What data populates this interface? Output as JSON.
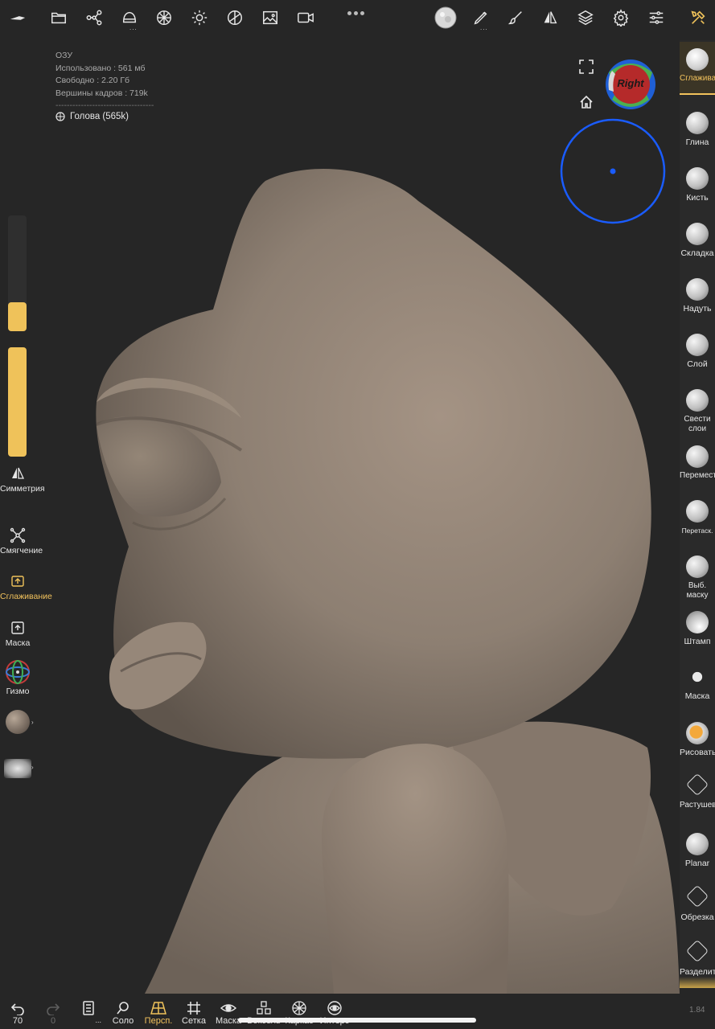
{
  "stats": {
    "title": "ОЗУ",
    "used": "Использовано : 561 мб",
    "free": "Свободно : 2.20 Гб",
    "vertices": "Вершины кадров : 719k",
    "separator": "-----------------------------------",
    "mesh_name": "Голова (565k)"
  },
  "gizmo": {
    "face_label": "Right"
  },
  "left_panel": {
    "symmetry": "Симметрия",
    "smoothing": "Смягчение",
    "smooth_active": "Сглаживание",
    "mask": "Маска",
    "gizmo": "Гизмо",
    "slider_top_level": 0.25,
    "slider_bottom_level": 1.0
  },
  "brushes": [
    {
      "label": "Сглаживание",
      "icon": "smooth-brush-icon",
      "active": true
    },
    {
      "label": "Глина",
      "icon": "clay-brush-icon"
    },
    {
      "label": "Кисть",
      "icon": "brush-icon"
    },
    {
      "label": "Складка",
      "icon": "crease-brush-icon"
    },
    {
      "label": "Надуть",
      "icon": "inflate-brush-icon"
    },
    {
      "label": "Слой",
      "icon": "layer-brush-icon"
    },
    {
      "label": "Свести слои",
      "icon": "flatten-brush-icon"
    },
    {
      "label": "Переместить",
      "icon": "move-brush-icon"
    },
    {
      "label": "Перетаск.",
      "icon": "drag-brush-icon"
    },
    {
      "label": "Выб. маску",
      "icon": "select-mask-brush-icon"
    },
    {
      "label": "Штамп",
      "icon": "stamp-brush-icon"
    },
    {
      "label": "Маска",
      "icon": "mask-brush-icon"
    },
    {
      "label": "Рисовать",
      "icon": "paint-brush-icon"
    },
    {
      "label": "Растушевка",
      "icon": "smudge-brush-icon"
    },
    {
      "label": "Planar",
      "icon": "planar-brush-icon"
    },
    {
      "label": "Обрезка",
      "icon": "trim-brush-icon"
    },
    {
      "label": "Разделить",
      "icon": "split-brush-icon"
    }
  ],
  "bottom_bar": {
    "undo_count": "70",
    "redo_count": "0",
    "solo": "Соло",
    "persp": "Персп.",
    "grid": "Сетка",
    "mask": "Маска",
    "voxel": "Вокcель",
    "wireframe": "Каркас",
    "matcap": "Интерс",
    "more": "..."
  },
  "version": "1.84",
  "colors": {
    "accent": "#efc25a",
    "background": "#262626",
    "sculpt": "#8b7d70",
    "pivot_ring": "#1a5cff"
  }
}
